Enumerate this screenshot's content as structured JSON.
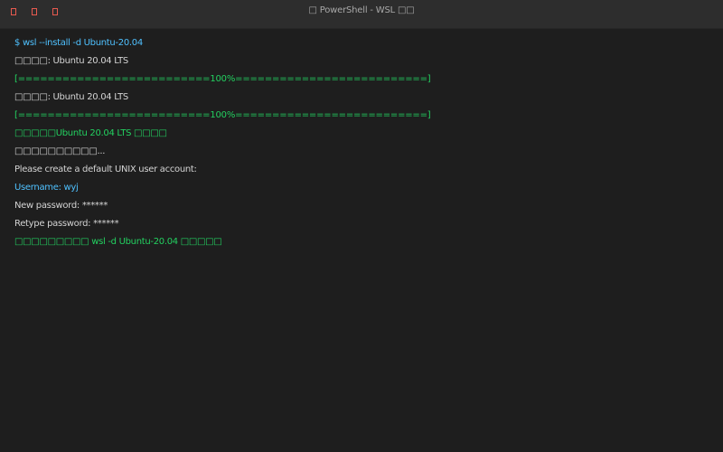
{
  "window": {
    "title": "□ PowerShell - WSL □□"
  },
  "controls": [
    {
      "name": "close-button",
      "glyph": "□"
    },
    {
      "name": "minimize-button",
      "glyph": "□"
    },
    {
      "name": "maximize-button",
      "glyph": "□"
    }
  ],
  "colors": {
    "background": "#1e1e1e",
    "titlebar": "#2d2d2d",
    "command": "#4fc1ff",
    "output": "#d4d4d4",
    "success": "#23d160",
    "control": "#ff5f57"
  },
  "terminal": {
    "lines": [
      {
        "kind": "cmd",
        "text": "$ wsl --install -d Ubuntu-20.04"
      },
      {
        "kind": "out",
        "text": "□□□□: Ubuntu 20.04 LTS"
      },
      {
        "kind": "bar",
        "text": "[==========================100%==========================]"
      },
      {
        "kind": "out",
        "text": "□□□□: Ubuntu 20.04 LTS"
      },
      {
        "kind": "bar",
        "text": "[==========================100%==========================]"
      },
      {
        "kind": "ok",
        "text": "□□□□□Ubuntu 20.04 LTS □□□□"
      },
      {
        "kind": "out",
        "text": "□□□□□□□□□□..."
      },
      {
        "kind": "out",
        "text": "Please create a default UNIX user account:"
      },
      {
        "kind": "cmd",
        "text": "Username: wyj"
      },
      {
        "kind": "out",
        "text": "New password: ******"
      },
      {
        "kind": "out",
        "text": "Retype password: ******"
      },
      {
        "kind": "ok",
        "text": "□□□□□□□□□ wsl -d Ubuntu-20.04 □□□□□"
      }
    ]
  }
}
